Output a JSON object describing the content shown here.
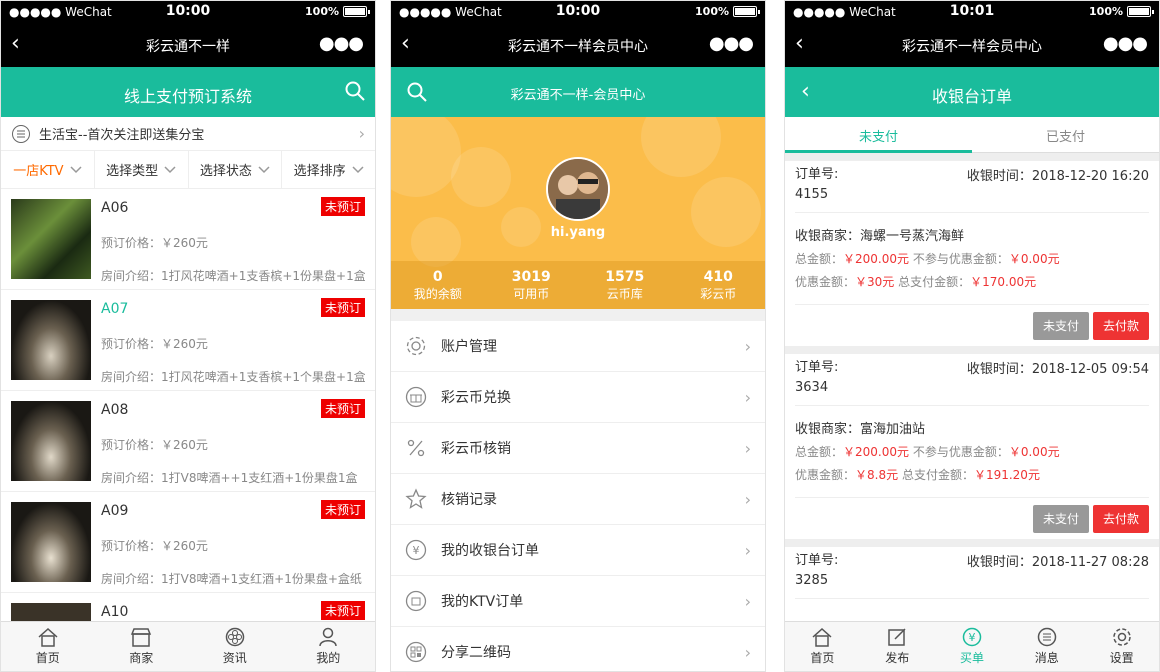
{
  "status_bars": [
    {
      "carrier": "●●●●● WeChat",
      "time": "10:00",
      "battery": "100%"
    },
    {
      "carrier": "●●●●● WeChat",
      "time": "10:00",
      "battery": "100%"
    },
    {
      "carrier": "●●●●● WeChat",
      "time": "10:01",
      "battery": "100%"
    }
  ],
  "screen1": {
    "wx_title": "彩云通不一样",
    "header_title": "线上支付预订系统",
    "notice": "生活宝--首次关注即送集分宝",
    "filters": [
      "一店KTV",
      "选择类型",
      "选择状态",
      "选择排序"
    ],
    "rooms": [
      {
        "name": "A06",
        "price": "预订价格：￥260元",
        "desc": "房间介绍：1打风花啤酒+1支香槟+1份果盘+1盒",
        "badge": "未预订"
      },
      {
        "name": "A07",
        "price": "预订价格：￥260元",
        "desc": "房间介绍：1打风花啤酒+1支香槟+1个果盘+1盒",
        "badge": "未预订"
      },
      {
        "name": "A08",
        "price": "预订价格：￥260元",
        "desc": "房间介绍：1打V8啤酒++1支红酒+1份果盘1盒",
        "badge": "未预订"
      },
      {
        "name": "A09",
        "price": "预订价格：￥260元",
        "desc": "房间介绍：1打V8啤酒+1支红酒+1份果盘+盒纸",
        "badge": "未预订"
      },
      {
        "name": "A10",
        "price": "",
        "desc": "",
        "badge": "未预订"
      }
    ],
    "tabs": [
      "首页",
      "商家",
      "资讯",
      "我的"
    ]
  },
  "screen2": {
    "wx_title": "彩云通不一样会员中心",
    "header_title": "彩云通不一样-会员中心",
    "username": "hi.yang",
    "stats": [
      {
        "value": "0",
        "label": "我的余额"
      },
      {
        "value": "3019",
        "label": "可用币"
      },
      {
        "value": "1575",
        "label": "云币库"
      },
      {
        "value": "410",
        "label": "彩云币"
      }
    ],
    "menu": [
      "账户管理",
      "彩云币兑换",
      "彩云币核销",
      "核销记录",
      "我的收银台订单",
      "我的KTV订单",
      "分享二维码"
    ]
  },
  "screen3": {
    "wx_title": "彩云通不一样会员中心",
    "header_title": "收银台订单",
    "tabs": [
      "未支付",
      "已支付"
    ],
    "orders": [
      {
        "no_label": "订单号:",
        "no": "4155",
        "time": "收银时间：2018-12-20 16:20",
        "merchant": "收银商家：海螺一号蒸汽海鲜",
        "total_label": "总金额：",
        "total": "￥200.00元",
        "nodisc_label": "不参与优惠金额：",
        "nodisc": "￥0.00元",
        "disc_label": "优惠金额：",
        "disc": "￥30元",
        "pay_label": "总支付金额：",
        "pay": "￥170.00元"
      },
      {
        "no_label": "订单号:",
        "no": "3634",
        "time": "收银时间：2018-12-05 09:54",
        "merchant": "收银商家：富海加油站",
        "total_label": "总金额：",
        "total": "￥200.00元",
        "nodisc_label": "不参与优惠金额：",
        "nodisc": "￥0.00元",
        "disc_label": "优惠金额：",
        "disc": "￥8.8元",
        "pay_label": "总支付金额：",
        "pay": "￥191.20元"
      },
      {
        "no_label": "订单号:",
        "no": "3285",
        "time": "收银时间：2018-11-27 08:28"
      }
    ],
    "btn_unpaid": "未支付",
    "btn_pay": "去付款",
    "tabbar": [
      "首页",
      "发布",
      "买单",
      "消息",
      "设置"
    ]
  }
}
